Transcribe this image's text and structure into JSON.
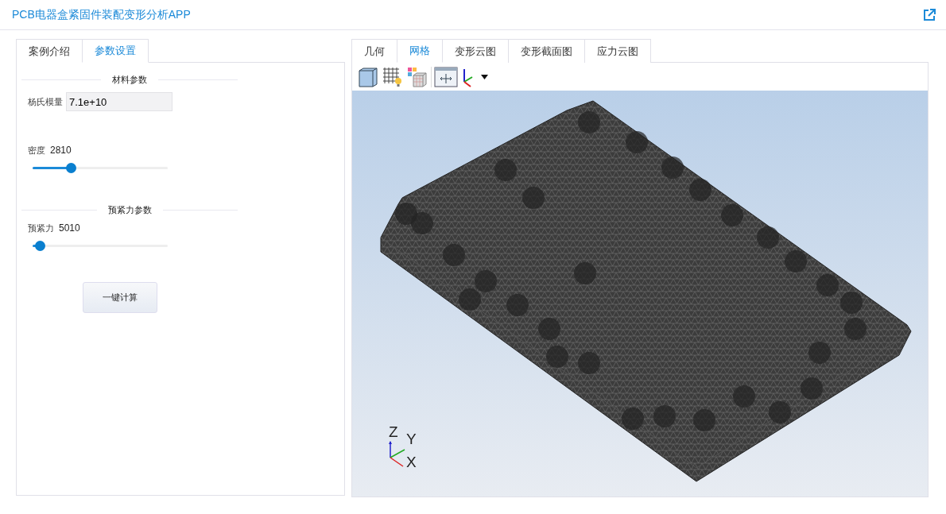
{
  "header": {
    "title": "PCB电器盒紧固件装配变形分析APP"
  },
  "left_tabs": [
    {
      "label": "案例介绍",
      "selected": false
    },
    {
      "label": "参数设置",
      "selected": true
    }
  ],
  "sections": [
    {
      "title": "材料参数",
      "params": [
        {
          "kind": "field",
          "label": "杨氏模量",
          "value": "7.1e+10"
        },
        {
          "kind": "slider",
          "label": "密度",
          "reading": "2810",
          "level": 0.28
        }
      ]
    },
    {
      "title": "预紧力参数",
      "params": [
        {
          "kind": "slider",
          "label": "预紧力",
          "reading": "5010",
          "level": 0.05
        }
      ]
    }
  ],
  "compute_button": "一键计算",
  "view_tabs": [
    {
      "label": "几何",
      "selected": false
    },
    {
      "label": "网格",
      "selected": true
    },
    {
      "label": "变形云图",
      "selected": false
    },
    {
      "label": "变形截面图",
      "selected": false
    },
    {
      "label": "应力云图",
      "selected": false
    }
  ],
  "axis_labels": {
    "z": "Z",
    "y": "Y",
    "x": "X"
  }
}
